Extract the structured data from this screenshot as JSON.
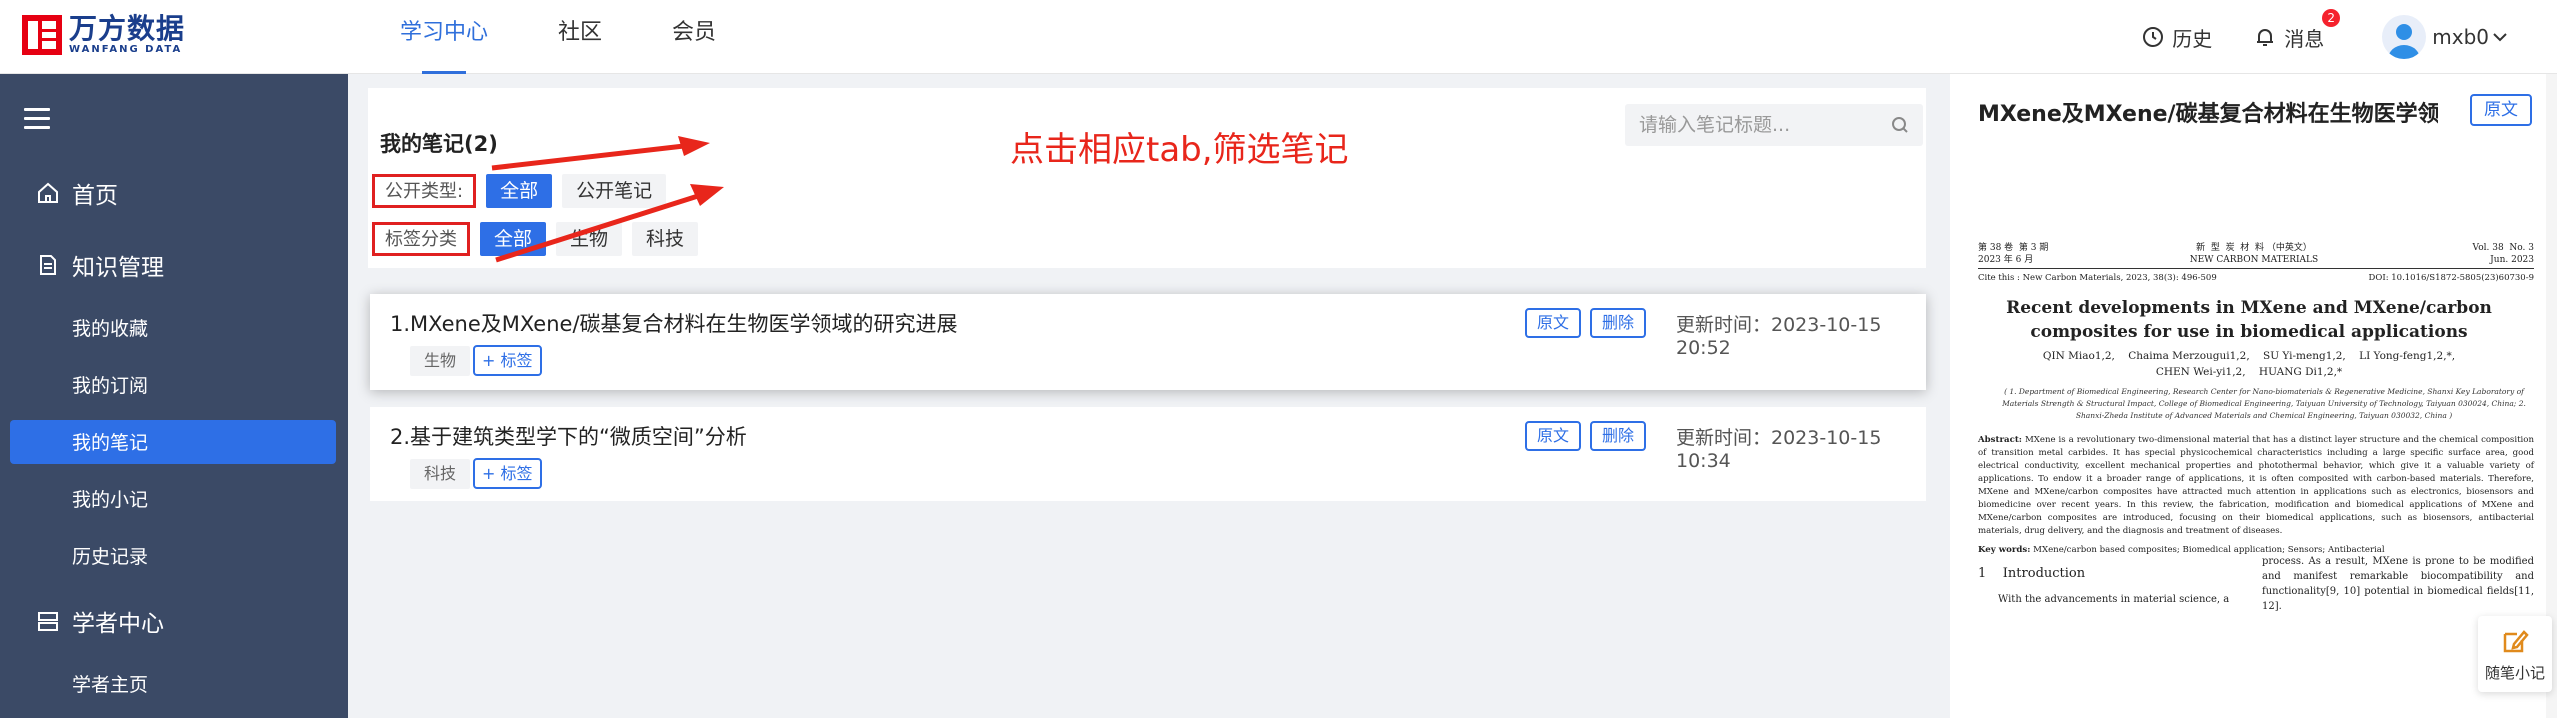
{
  "header": {
    "logo_cn": "万方数据",
    "logo_en": "WANFANG DATA",
    "nav": [
      "学习中心",
      "社区",
      "会员"
    ],
    "history": "历史",
    "messages": "消息",
    "message_count": "2",
    "username": "mxb0",
    "icons": {
      "history": "clock-icon",
      "messages": "bell-icon",
      "user": "chevron-down-icon"
    }
  },
  "sidebar": {
    "home": "首页",
    "knowledge": "知识管理",
    "knowledge_items": [
      "我的收藏",
      "我的订阅",
      "我的笔记",
      "我的小记",
      "历史记录"
    ],
    "scholar": "学者中心",
    "scholar_items": [
      "学者主页"
    ],
    "active_item": "我的笔记",
    "colors": {
      "bg": "#3b4a66",
      "active": "#2e6fe6"
    }
  },
  "main": {
    "title": "我的笔记(2)",
    "search_placeholder": "请输入笔记标题...",
    "public_label": "公开类型:",
    "public_options": [
      "全部",
      "公开笔记"
    ],
    "tag_label": "标签分类",
    "tag_options": [
      "全部",
      "生物",
      "科技"
    ],
    "annotation": "点击相应tab,筛选笔记",
    "btn_original": "原文",
    "btn_delete": "删除",
    "btn_add_tag": "+ 标签",
    "notes": [
      {
        "title": "1.MXene及MXene/碳基复合材料在生物医学领域的研究进展",
        "tag": "生物",
        "time": "更新时间：2023-10-15 20:52"
      },
      {
        "title": "2.基于建筑类型学下的“微质空间”分析",
        "tag": "科技",
        "time": "更新时间：2023-10-15 10:34"
      }
    ]
  },
  "preview": {
    "title": "MXene及MXene/碳基复合材料在生物医学领...",
    "btn": "原文",
    "quick_note": "随笔小记",
    "paper": {
      "hdr_left": "第 38 卷  第 3 期\n2023 年 6 月",
      "hdr_mid": "新  型  炭  材  料 （中英文）\nNEW CARBON MATERIALS",
      "hdr_right": "Vol. 38  No. 3\nJun. 2023",
      "cite": "Cite this : New Carbon Materials, 2023, 38(3): 496-509",
      "doi": "DOI: 10.1016/S1872-5805(23)60730-9",
      "title": "Recent developments in MXene and MXene/carbon composites for use in biomedical applications",
      "authors": "QIN Miao1,2,    Chaima Merzougui1,2,    SU Yi-meng1,2,    LI Yong-feng1,2,*,\nCHEN Wei-yi1,2,    HUANG Di1,2,*",
      "affiliations": "( 1. Department of Biomedical Engineering, Research Center for Nano-biomaterials & Regenerative Medicine, Shanxi Key Laboratory of Materials Strength & Structural Impact, College of Biomedical Engineering, Taiyuan University of Technology, Taiyuan 030024, China; 2. Shanxi-Zheda Institute of Advanced Materials and Chemical Engineering, Taiyuan 030032, China )",
      "abstract_label": "Abstract:",
      "abstract": "MXene is a revolutionary two-dimensional material that has a distinct layer structure and the chemical composition of transition metal carbides. It has special physicochemical characteristics including a large specific surface area, good electrical conductivity, excellent mechanical properties and photothermal behavior, which give it a valuable variety of applications. To endow it a broader range of applications, it is often composited with carbon-based materials. Therefore, MXene and MXene/carbon composites have attracted much attention in applications such as electronics, biosensors and biomedicine over recent years. In this review, the fabrication, modification and biomedical applications of MXene and MXene/carbon composites are introduced, focusing on their biomedical applications, such as biosensors, antibacterial materials, drug delivery, and the diagnosis and treatment of diseases.",
      "keywords_label": "Key words:",
      "keywords": "MXene/carbon based composites; Biomedical application; Sensors; Antibacterial",
      "section": "1    Introduction",
      "col1": "With the advancements in material science, a",
      "col2": "process. As a result, MXene is prone to be modified and manifest remarkable biocompatibility and functionality[9, 10] potential in biomedical fields[11, 12]."
    }
  }
}
